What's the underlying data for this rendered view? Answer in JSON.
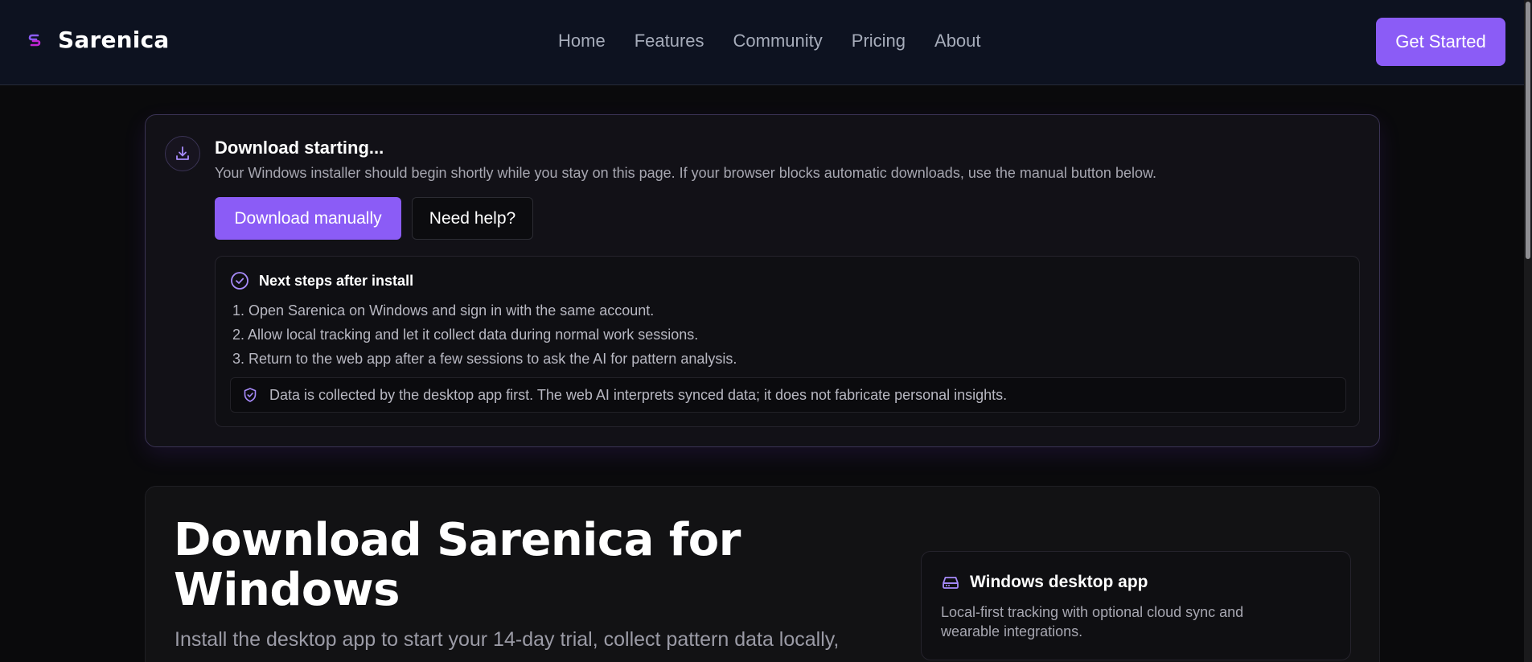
{
  "nav": {
    "brand": "Sarenica",
    "links": [
      "Home",
      "Features",
      "Community",
      "Pricing",
      "About"
    ],
    "cta": "Get Started"
  },
  "download": {
    "title": "Download starting...",
    "description": "Your Windows installer should begin shortly while you stay on this page. If your browser blocks automatic downloads, use the manual button below.",
    "primary_button": "Download manually",
    "secondary_button": "Need help?",
    "steps": {
      "heading": "Next steps after install",
      "items": [
        "1. Open Sarenica on Windows and sign in with the same account.",
        "2. Allow local tracking and let it collect data during normal work sessions.",
        "3. Return to the web app after a few sessions to ask the AI for pattern analysis."
      ],
      "notice": "Data is collected by the desktop app first. The web AI interprets synced data; it does not fabricate personal insights."
    }
  },
  "hero": {
    "title": "Download Sarenica for Windows",
    "subtitle": "Install the desktop app to start your 14-day trial, collect pattern data locally,",
    "feature": {
      "title": "Windows desktop app",
      "description": "Local-first tracking with optional cloud sync and wearable integrations."
    }
  },
  "colors": {
    "accent": "#8b5cf6",
    "nav_background": "#0d1220",
    "page_background": "#0a0a0c"
  },
  "icons": {
    "brand": "sarenica-logo-icon",
    "download": "download-icon",
    "steps": "check-circle-icon",
    "notice": "shield-check-icon",
    "feature": "hard-drive-icon"
  }
}
